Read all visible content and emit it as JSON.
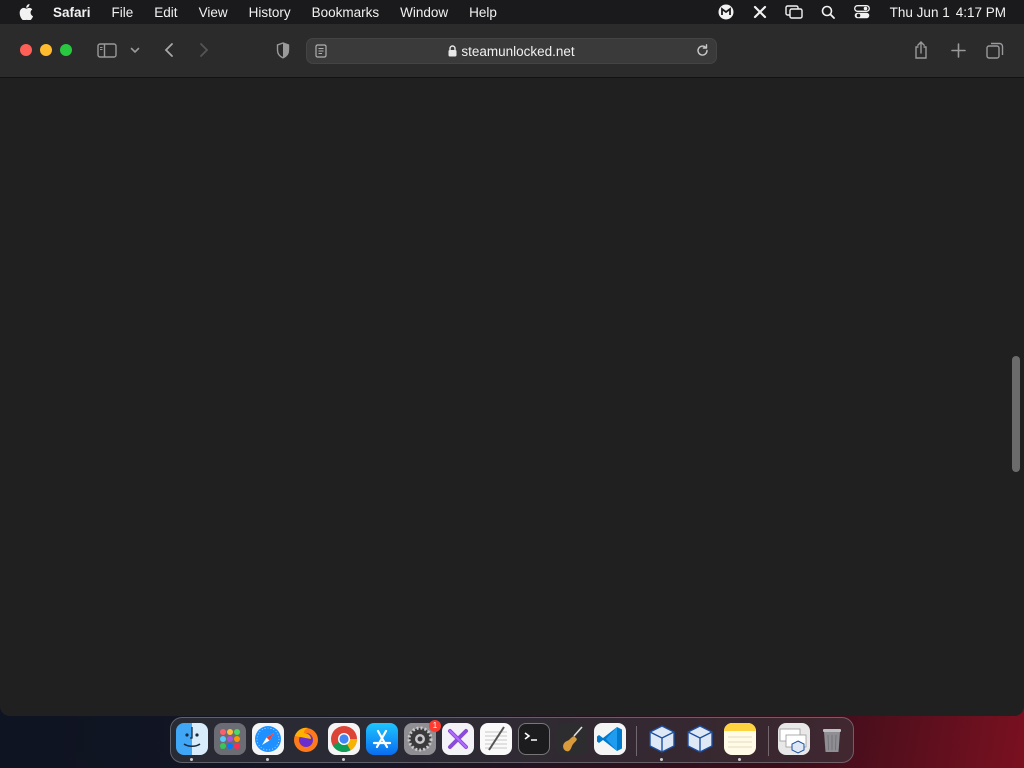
{
  "menubar": {
    "apple_icon": "apple-logo-icon",
    "app_name": "Safari",
    "items": [
      "File",
      "Edit",
      "View",
      "History",
      "Bookmarks",
      "Window",
      "Help"
    ],
    "status_icons": [
      "malwarebytes-icon",
      "x-tool-icon",
      "screen-mirroring-icon",
      "search-icon",
      "control-center-icon"
    ],
    "date": "Thu Jun 1",
    "time": "4:17 PM"
  },
  "toolbar": {
    "url": "steamunlocked.net",
    "icons": [
      "sidebar-icon",
      "chevron-down-icon",
      "back-icon",
      "forward-icon",
      "privacy-shield-icon",
      "reader-icon",
      "lock-icon",
      "reload-icon",
      "share-icon",
      "new-tab-icon",
      "tab-overview-icon"
    ]
  },
  "dock": {
    "apps": [
      {
        "name": "finder",
        "running": true
      },
      {
        "name": "launchpad",
        "running": false
      },
      {
        "name": "safari",
        "running": true
      },
      {
        "name": "firefox",
        "running": false
      },
      {
        "name": "chrome",
        "running": true
      },
      {
        "name": "app-store",
        "running": false
      },
      {
        "name": "system-preferences",
        "running": false,
        "badge": "1"
      },
      {
        "name": "utility-app",
        "running": false
      },
      {
        "name": "textedit",
        "running": false
      },
      {
        "name": "terminal",
        "running": false
      },
      {
        "name": "instruments",
        "running": false
      },
      {
        "name": "vscode",
        "running": false
      },
      {
        "name": "virtualbox",
        "running": true
      },
      {
        "name": "virtualbox-vm",
        "running": false
      },
      {
        "name": "notes",
        "running": true
      },
      {
        "name": "downloads-stack",
        "running": false
      },
      {
        "name": "trash",
        "running": false
      }
    ]
  },
  "colors": {
    "close": "#fe5f57",
    "minimize": "#febc2e",
    "maximize": "#28c840",
    "badge": "#ff3b30"
  }
}
